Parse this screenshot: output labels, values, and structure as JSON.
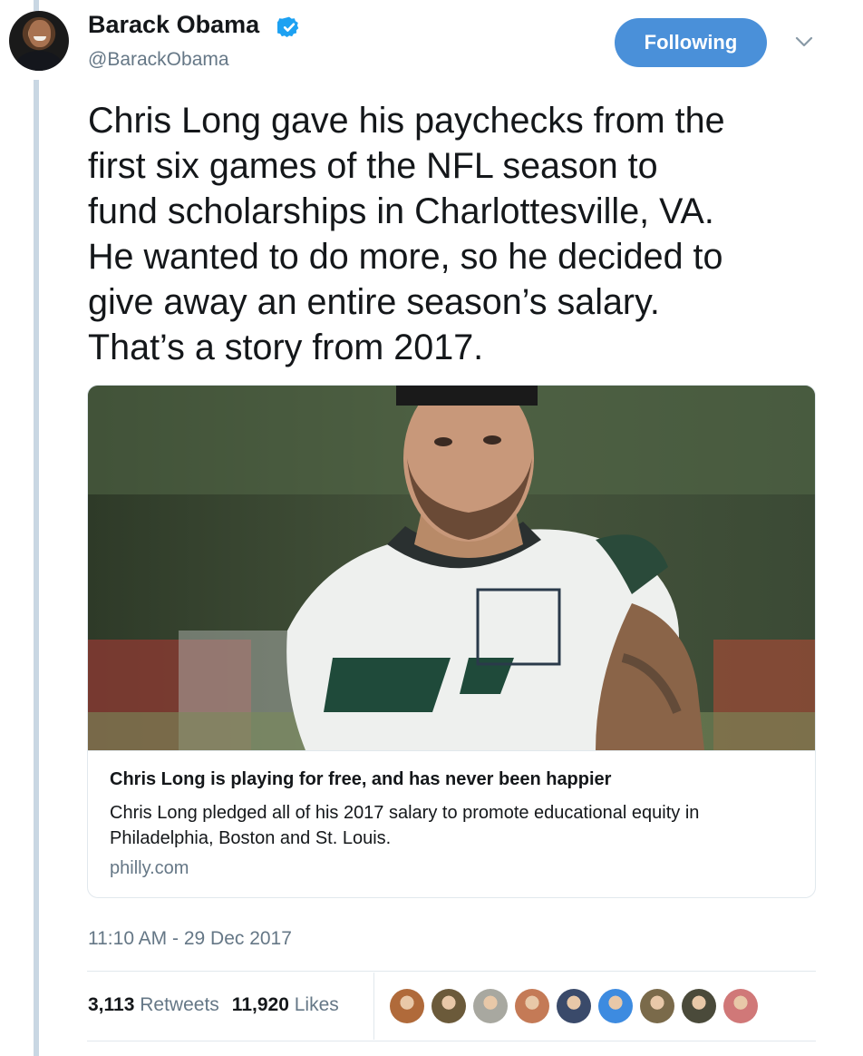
{
  "tweet": {
    "author_name": "Barack Obama",
    "author_handle": "@BarackObama",
    "follow_label": "Following",
    "text": "Chris Long gave his paychecks from the\nfirst six games of the NFL season to\nfund scholarships in Charlottesville, VA.\nHe wanted to do more, so he decided to\ngive away an entire season’s salary.\nThat’s a story from 2017.",
    "timestamp": "11:10 AM - 29 Dec 2017"
  },
  "card": {
    "title": "Chris Long is playing for free, and has never been happier",
    "description": "Chris Long pledged all of his 2017 salary to promote educational equity in Philadelphia, Boston and St. Louis.",
    "domain": "philly.com"
  },
  "stats": {
    "retweets_count": "3,113",
    "retweets_label": "Retweets",
    "likes_count": "11,920",
    "likes_label": "Likes"
  },
  "likers": [
    {
      "color": "#b06a3a"
    },
    {
      "color": "#6b5a3a"
    },
    {
      "color": "#a8a8a0"
    },
    {
      "color": "#c47a56"
    },
    {
      "color": "#3a4a6a"
    },
    {
      "color": "#3d8be0"
    },
    {
      "color": "#7a6a4a"
    },
    {
      "color": "#4a4a3a"
    },
    {
      "color": "#d07878"
    }
  ],
  "colors": {
    "accent": "#4a90d9",
    "verified": "#1da1f2",
    "muted": "#657786"
  },
  "icons": {
    "verified": "verified-badge-icon",
    "dropdown": "chevron-down-icon"
  }
}
